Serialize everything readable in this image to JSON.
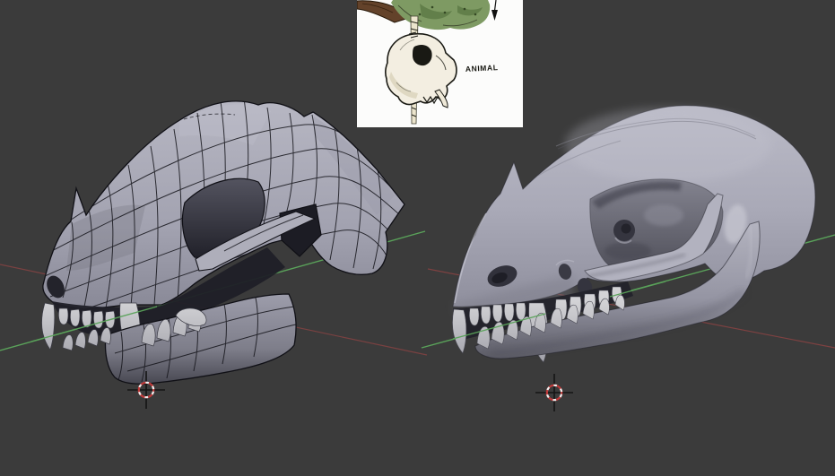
{
  "reference": {
    "label": "ANIMAL",
    "background": "#fcfcfb",
    "elements": [
      "tree-branch",
      "foliage",
      "hanging-pole",
      "skull-sketch",
      "down-arrow"
    ]
  },
  "colors": {
    "background": "#3b3b3b",
    "axis_green": "#5aa35a",
    "axis_red": "#8f4343",
    "cursor_ring_red": "#c03a3a",
    "cursor_ring_white": "#f0f0f0",
    "model_base_gray": "#a6a6b2",
    "wire_line": "#15151b",
    "reference_background": "#fcfcfb"
  },
  "viewports": {
    "left": {
      "content": "low-poly wireframe animal skull mesh"
    },
    "right": {
      "content": "smooth sculpted animal skull model"
    }
  }
}
